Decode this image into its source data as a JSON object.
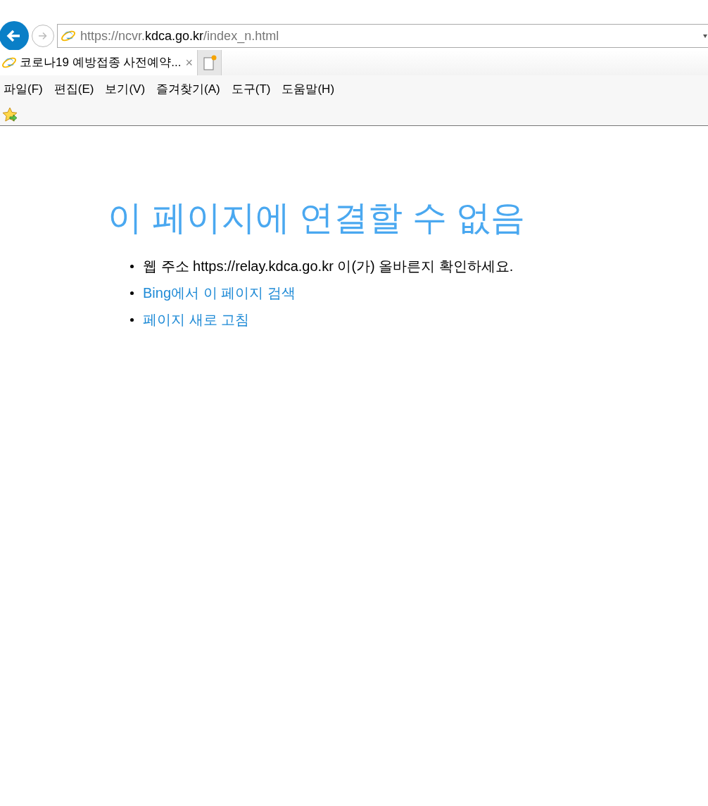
{
  "address_bar": {
    "scheme": "https://ncvr.",
    "host": "kdca.go.kr",
    "path": "/index_n.html"
  },
  "tabs": [
    {
      "title": "코로나19 예방접종 사전예약...",
      "close": "×",
      "selected": true
    }
  ],
  "menu": [
    "파일(F)",
    "편집(E)",
    "보기(V)",
    "즐겨찾기(A)",
    "도구(T)",
    "도움말(H)"
  ],
  "error_page": {
    "heading": "이 페이지에 연결할 수 없음",
    "items": [
      {
        "kind": "text",
        "text": "웹 주소 https://relay.kdca.go.kr 이(가) 올바른지 확인하세요."
      },
      {
        "kind": "link",
        "text": "Bing에서 이 페이지 검색"
      },
      {
        "kind": "link",
        "text": "페이지 새로 고침"
      }
    ]
  }
}
